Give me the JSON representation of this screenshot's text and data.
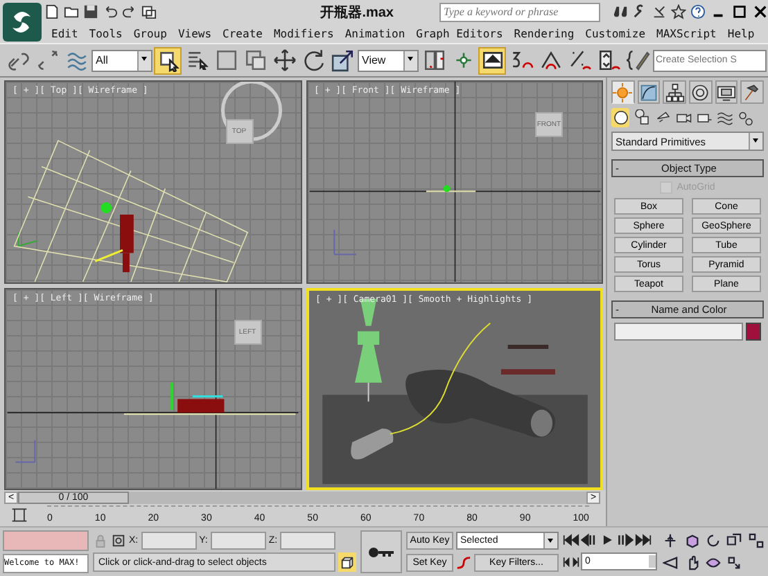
{
  "window": {
    "title": "开瓶器.max"
  },
  "search": {
    "placeholder": "Type a keyword or phrase"
  },
  "menu": [
    "Edit",
    "Tools",
    "Group",
    "Views",
    "Create",
    "Modifiers",
    "Animation",
    "Graph Editors",
    "Rendering",
    "Customize",
    "MAXScript",
    "Help"
  ],
  "toolbar": [
    {
      "kind": "link",
      "active": false
    },
    {
      "kind": "unlink",
      "active": false
    },
    {
      "kind": "bind",
      "active": false
    },
    {
      "kind": "dropdown",
      "value": "All"
    },
    {
      "kind": "select",
      "active": true
    },
    {
      "kind": "select-by-name",
      "active": false
    },
    {
      "kind": "region",
      "active": false
    },
    {
      "kind": "crossing",
      "active": false
    },
    {
      "kind": "move",
      "active": false
    },
    {
      "kind": "rotate",
      "active": false
    },
    {
      "kind": "scale",
      "active": false
    },
    {
      "kind": "dropdown",
      "value": "View"
    },
    {
      "kind": "pivot",
      "active": false
    },
    {
      "kind": "manipulate",
      "active": false
    },
    {
      "kind": "shortcut",
      "active": true
    },
    {
      "kind": "snap",
      "active": false
    },
    {
      "kind": "angle-snap",
      "active": false
    },
    {
      "kind": "percent-snap",
      "active": false
    },
    {
      "kind": "spinner-snap",
      "active": false
    },
    {
      "kind": "edit-named",
      "active": false
    },
    {
      "kind": "named-field",
      "placeholder": "Create Selection S"
    }
  ],
  "viewports": [
    {
      "kind": "top",
      "label": "[ + ][ Top ][ Wireframe ]",
      "active": false,
      "cube": "TOP"
    },
    {
      "kind": "front",
      "label": "[ + ][ Front ][ Wireframe ]",
      "active": false,
      "cube": "FRONT"
    },
    {
      "kind": "left",
      "label": "[ + ][ Left ][ Wireframe ]",
      "active": false,
      "cube": "LEFT"
    },
    {
      "kind": "camera",
      "label": "[ + ][ Camera01 ][ Smooth + Highlights ]",
      "active": true
    }
  ],
  "command_panel": {
    "tabs": [
      {
        "kind": "create",
        "selected": true
      },
      {
        "kind": "modify",
        "selected": false
      },
      {
        "kind": "hierarchy",
        "selected": false
      },
      {
        "kind": "motion",
        "selected": false
      },
      {
        "kind": "display",
        "selected": false
      },
      {
        "kind": "utilities",
        "selected": false
      }
    ],
    "categories": [
      {
        "kind": "geometry",
        "selected": true
      },
      {
        "kind": "shapes",
        "selected": false
      },
      {
        "kind": "lights",
        "selected": false
      },
      {
        "kind": "cameras",
        "selected": false
      },
      {
        "kind": "helpers",
        "selected": false
      },
      {
        "kind": "spacewarps",
        "selected": false
      },
      {
        "kind": "systems",
        "selected": false
      }
    ],
    "type_dropdown": "Standard Primitives",
    "object_type": {
      "collapse": "-",
      "title": "Object Type",
      "autogrid": {
        "label": "AutoGrid",
        "checked": false,
        "disabled": true
      },
      "buttons": [
        "Box",
        "Cone",
        "Sphere",
        "GeoSphere",
        "Cylinder",
        "Tube",
        "Torus",
        "Pyramid",
        "Teapot",
        "Plane"
      ]
    },
    "name_and_color": {
      "collapse": "-",
      "title": "Name and Color",
      "color": "#a0103c"
    }
  },
  "timeline": {
    "frame": "0 / 100",
    "prev": "<",
    "next": ">",
    "ticks": [
      "0",
      "10",
      "20",
      "30",
      "40",
      "50",
      "60",
      "70",
      "80",
      "90",
      "100"
    ]
  },
  "status": {
    "listener": "Welcome to MAX!",
    "prompt": "Click or click-and-drag to select objects",
    "coords": [
      "X:",
      "Y:",
      "Z:"
    ],
    "auto_key": "Auto Key",
    "set_key": "Set Key",
    "key_mode": "Selected",
    "key_filters": "Key Filters...",
    "current_frame": "0"
  }
}
